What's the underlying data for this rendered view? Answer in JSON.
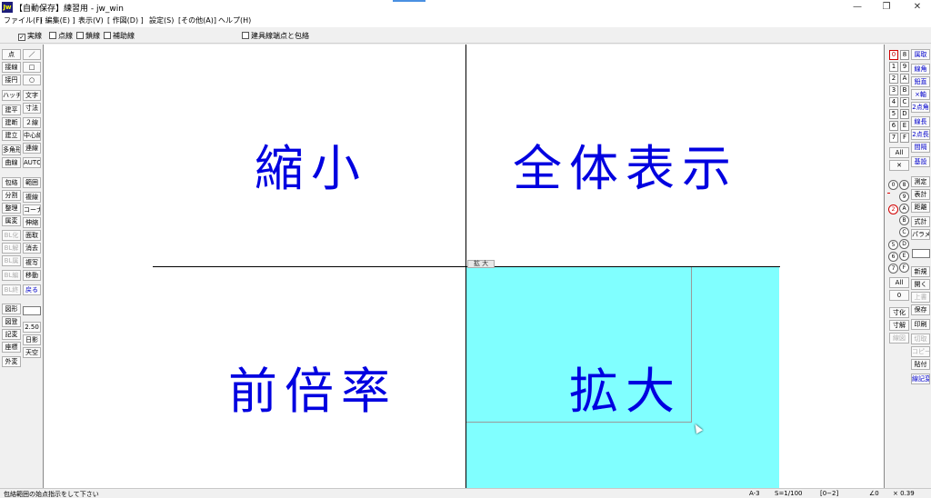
{
  "window": {
    "icon_text": "Jw",
    "title": "【自動保存】練習用 - jw_win",
    "minimize": "—",
    "maximize": "❐",
    "close": "✕"
  },
  "menu": [
    "ファイル(F)",
    "[ 編集(E) ]",
    "表示(V)",
    "[ 作図(D) ]",
    "設定(S)",
    "[その他(A)]",
    "ヘルプ(H)"
  ],
  "line_types": {
    "solid": "実線",
    "dotted": "点線",
    "chain": "鎖線",
    "aux": "補助線",
    "fixture": "建具線端点と包絡"
  },
  "canvas": {
    "zoom_tag": "拡 大",
    "labels": {
      "top_left": "縮小",
      "top_right": "全体表示",
      "bottom_left": "前倍率",
      "bottom_right": "拡大"
    }
  },
  "left_tools": {
    "col1": [
      "点",
      "接線",
      "接円",
      "ハッチ",
      "建平",
      "建断",
      "建立",
      "多角形",
      "曲線",
      "包絡",
      "分割",
      "整理",
      "属変",
      "BL化",
      "BL解",
      "BL属",
      "BL編",
      "BL終",
      "図形",
      "図登",
      "記変",
      "座標",
      "外変"
    ],
    "col2": [
      "／",
      "□",
      "○",
      "文字",
      "寸法",
      "２線",
      "中心線",
      "連線",
      "AUTO",
      "範囲",
      "複線",
      "コーナー",
      "伸縮",
      "面取",
      "消去",
      "複写",
      "移動",
      "戻る",
      "2.50",
      "日影",
      "天空"
    ]
  },
  "right_tools": {
    "layer_group_nums": [
      "0",
      "1",
      "2",
      "3",
      "4",
      "5",
      "6",
      "7",
      "All",
      "✕"
    ],
    "layer_group_hex": [
      "8",
      "9",
      "A",
      "B",
      "C",
      "D",
      "E",
      "F"
    ],
    "layer_circle_left": [
      "0",
      "2",
      "5",
      "6",
      "7"
    ],
    "layer_circle_right": [
      "8",
      "9",
      "A",
      "B",
      "C",
      "D",
      "E",
      "F"
    ],
    "layer_all": "All",
    "layer_zero": "0",
    "col_a": [
      "属取",
      "線角",
      "鉛直",
      "×軸",
      "2点角",
      "線長",
      "2点長",
      "間隔",
      "基設",
      "測定",
      "表計",
      "距離",
      "式計",
      "パラメ",
      "新規",
      "開く",
      "上書",
      "保存",
      "印刷",
      "切取",
      "コピー",
      "貼付",
      "線記変"
    ],
    "col_b": [
      "寸化",
      "寸解",
      "線図"
    ]
  },
  "status": {
    "message": "包絡範囲の始点指示をして下さい",
    "paper": "A-3",
    "scale": "S=1/100",
    "layer": "[0−2]",
    "angle": "∠0",
    "zoom": "× 0.39"
  },
  "colors": {
    "canvas_bg": "#ffffff",
    "zoom_fill": "#80ffff",
    "label": "#0000e0"
  }
}
